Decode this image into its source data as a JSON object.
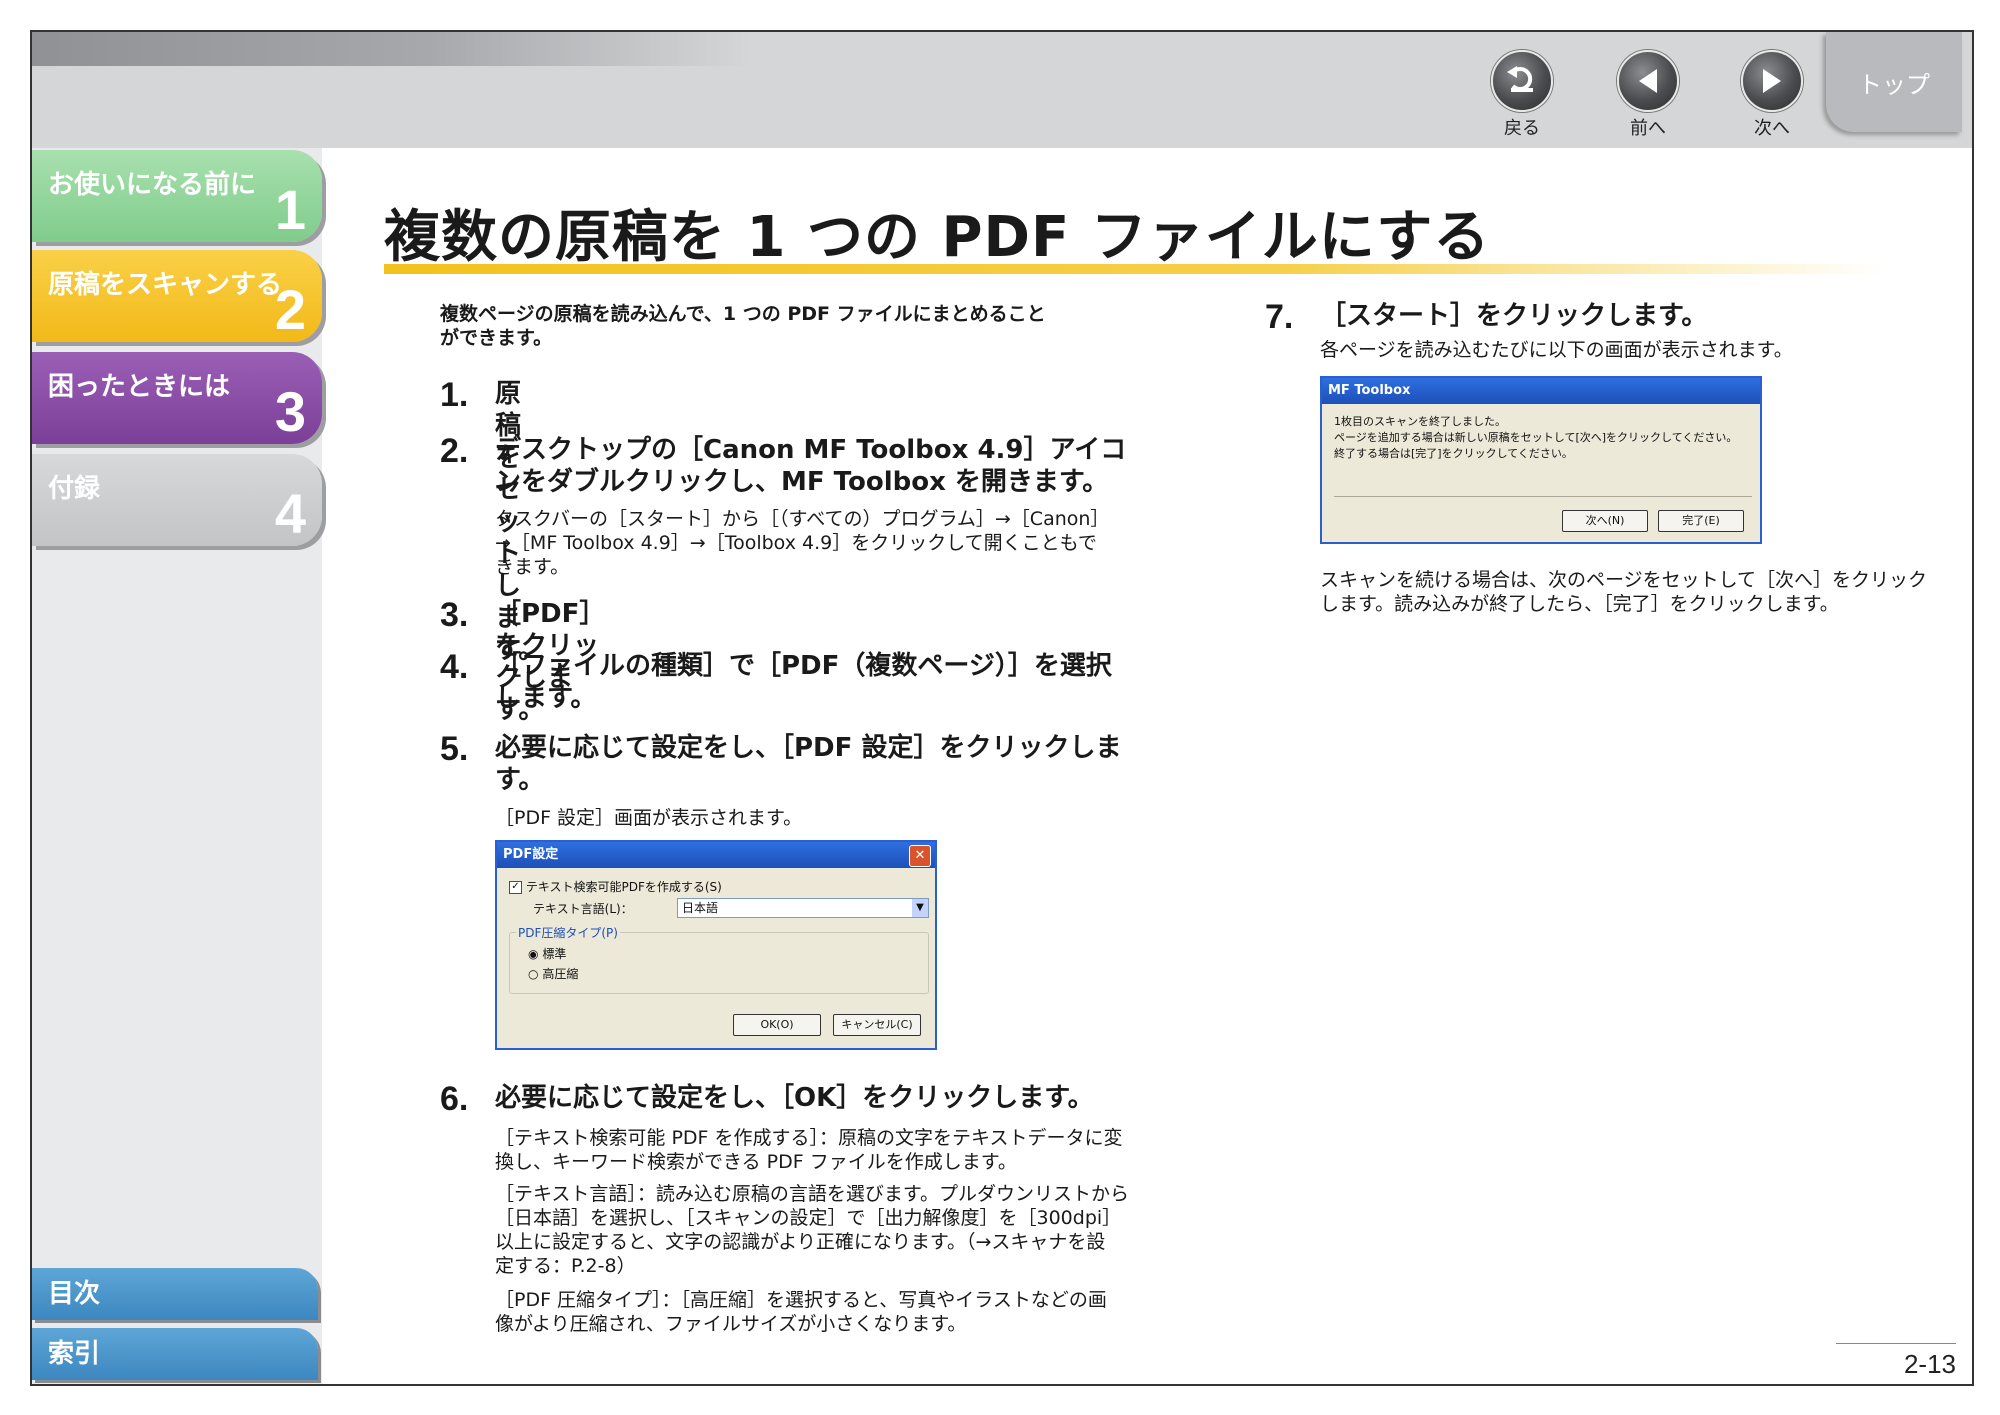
{
  "nav": {
    "back": "戻る",
    "prev": "前へ",
    "next": "次へ",
    "top": "トップ"
  },
  "chapters": [
    {
      "title": "お使いになる前に",
      "num": "1",
      "color": "#8fd49a"
    },
    {
      "title": "原稿をスキャンする",
      "num": "2",
      "color": "#f7c42a"
    },
    {
      "title": "困ったときには",
      "num": "3",
      "color": "#8b4fa6"
    },
    {
      "title": "付録",
      "num": "4",
      "color": "#c9cbcd"
    }
  ],
  "sidebar_buttons": {
    "contents": "目次",
    "index": "索引"
  },
  "page_title": "複数の原稿を 1 つの PDF ファイルにする",
  "intro": [
    "複数ページの原稿を読み込んで、1 つの PDF ファイルにまとめること",
    "ができます。"
  ],
  "steps": [
    {
      "num": "1.",
      "lines": [
        "原稿をセットします。"
      ]
    },
    {
      "num": "2.",
      "lines": [
        "デスクトップの［Canon MF Toolbox 4.9］アイコ",
        "ンをダブルクリックし、MF Toolbox を開きます。"
      ],
      "note": [
        "タスクバーの［スタート］から［（すべての）プログラム］→［Canon］",
        "→［MF Toolbox 4.9］→［Toolbox 4.9］をクリックして開くこともで",
        "きます。"
      ]
    },
    {
      "num": "3.",
      "lines": [
        "［PDF］をクリックします。"
      ]
    },
    {
      "num": "4.",
      "lines": [
        "［ファイルの種類］で［PDF（複数ページ）］を選択",
        "します。"
      ]
    },
    {
      "num": "5.",
      "lines": [
        "必要に応じて設定をし、［PDF 設定］をクリックしま",
        "す。"
      ],
      "note": [
        "［PDF 設定］画面が表示されます。"
      ]
    },
    {
      "num": "6.",
      "lines": [
        "必要に応じて設定をし、［OK］をクリックします。"
      ],
      "notes": [
        [
          "［テキスト検索可能 PDF を作成する］：原稿の文字をテキストデータに変",
          "換し、キーワード検索ができる PDF ファイルを作成します。"
        ],
        [
          "［テキスト言語］：読み込む原稿の言語を選びます。プルダウンリストから",
          "［日本語］を選択し、［スキャンの設定］で［出力解像度］を［300dpi］",
          "以上に設定すると、文字の認識がより正確になります。（→スキャナを設",
          "定する：P.2-8）"
        ],
        [
          "［PDF 圧縮タイプ］：［高圧縮］を選択すると、写真やイラストなどの画",
          "像がより圧縮され、ファイルサイズが小さくなります。"
        ]
      ]
    },
    {
      "num": "7.",
      "lines": [
        "［スタート］をクリックします。"
      ],
      "note": [
        "各ページを読み込むたびに以下の画面が表示されます。"
      ],
      "after": [
        "スキャンを続ける場合は、次のページをセットして［次へ］をクリック",
        "します。読み込みが終了したら、［完了］をクリックします。"
      ]
    }
  ],
  "pdf_dialog": {
    "title": "PDF設定",
    "checkbox": "テキスト検索可能PDFを作成する(S)",
    "lang_label": "テキスト言語(L)：",
    "lang_value": "日本語",
    "group": "PDF圧縮タイプ(P)",
    "radio1": "標準",
    "radio2": "高圧縮",
    "ok": "OK(O)",
    "cancel": "キャンセル(C)"
  },
  "mf_dialog": {
    "title": "MF Toolbox",
    "msg": [
      "1枚目のスキャンを終了しました。",
      "ページを追加する場合は新しい原稿をセットして[次へ]をクリックしてください。",
      "終了する場合は[完了]をクリックしてください。"
    ],
    "next": "次へ(N)",
    "done": "完了(E)"
  },
  "page_number": "2-13"
}
